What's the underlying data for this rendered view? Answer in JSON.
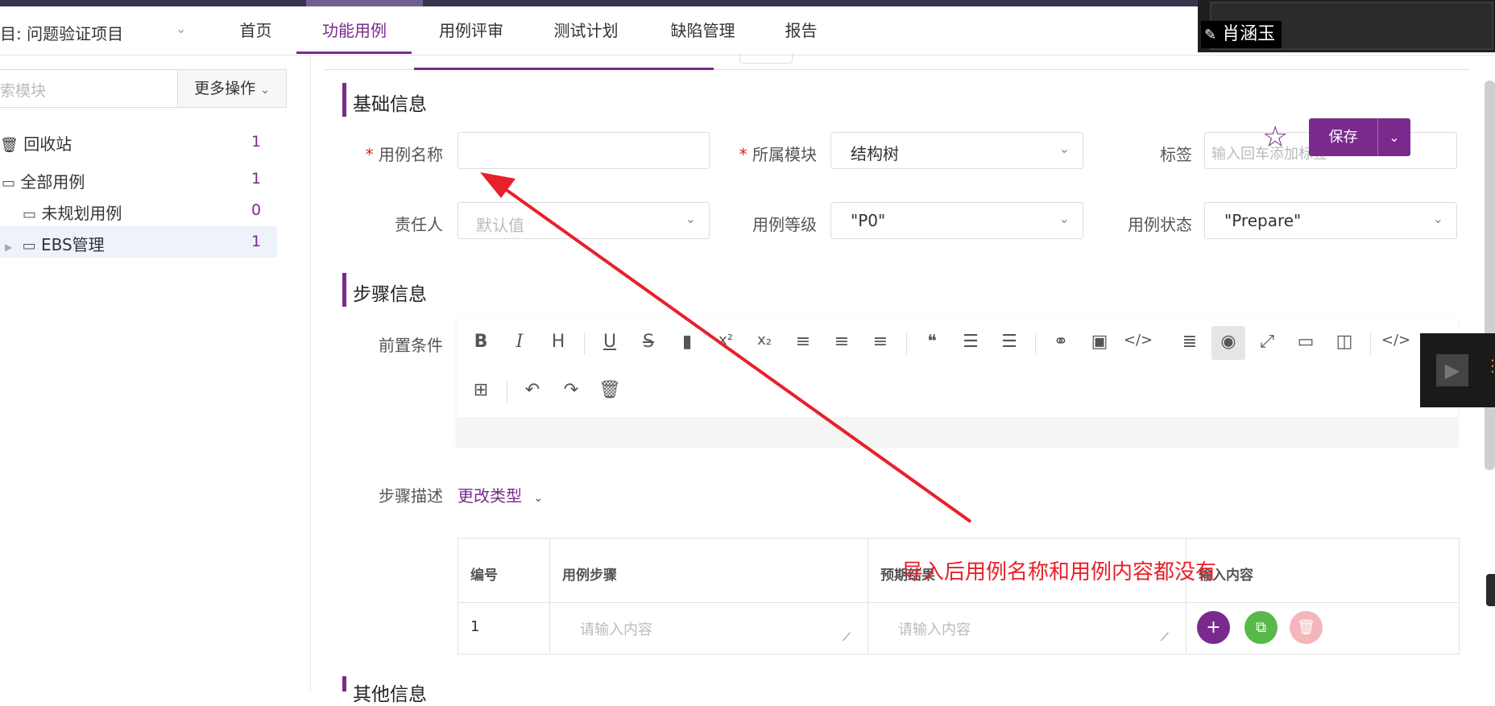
{
  "navbar": {
    "project": "目: 问题验证项目",
    "tabs": [
      "首页",
      "功能用例",
      "用例评审",
      "测试计划",
      "缺陷管理",
      "报告"
    ],
    "active_tab": "功能用例",
    "user_name": "肖涵玉"
  },
  "sidebar": {
    "search_placeholder": "索模块",
    "more_label": "更多操作",
    "items": [
      {
        "label": "回收站",
        "count": "1",
        "icon": "trash-icon"
      },
      {
        "label": "全部用例",
        "count": "1",
        "icon": "folder-icon"
      },
      {
        "label": "未规划用例",
        "count": "0",
        "icon": "folder-icon"
      },
      {
        "label": "EBS管理",
        "count": "1",
        "icon": "folder-icon"
      }
    ]
  },
  "form": {
    "basic_title": "基础信息",
    "name_label": "用例名称",
    "name_value": "",
    "module_label": "所属模块",
    "module_value": "结构树",
    "tag_label": "标签",
    "tag_placeholder": "输入回车添加标签",
    "owner_label": "责任人",
    "owner_placeholder": "默认值",
    "level_label": "用例等级",
    "level_value": "\"P0\"",
    "status_label": "用例状态",
    "status_value": "\"Prepare\"",
    "save_label": "保存"
  },
  "steps": {
    "title": "步骤信息",
    "precondition_label": "前置条件",
    "desc_label": "步骤描述",
    "change_type_label": "更改类型",
    "columns": [
      "编号",
      "用例步骤",
      "预期结果",
      "输入内容"
    ],
    "rows": [
      {
        "no": "1",
        "step_placeholder": "请输入内容",
        "expect_placeholder": "请输入内容"
      }
    ]
  },
  "other_title": "其他信息",
  "annotation": {
    "text": "导入后用例名称和用例内容都没有",
    "color": "#e8202a"
  },
  "colors": {
    "accent": "#7a2a8c"
  }
}
